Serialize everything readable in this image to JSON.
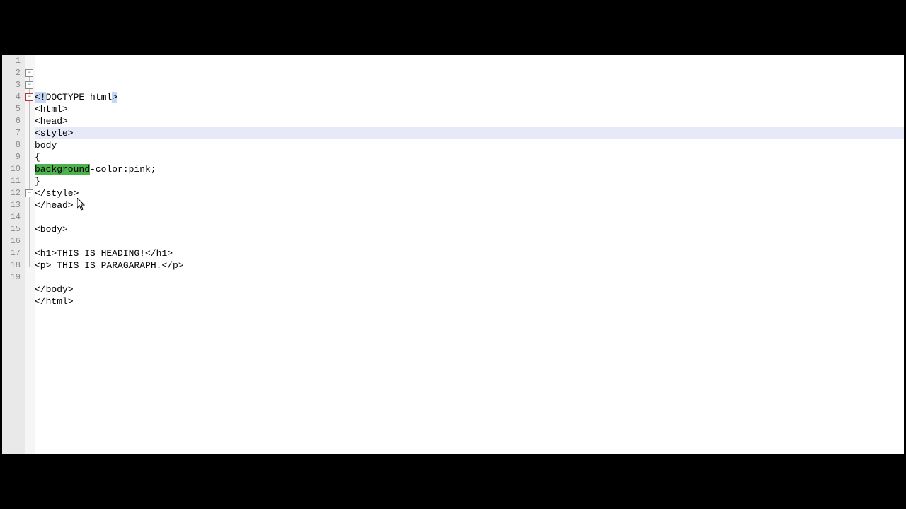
{
  "editor": {
    "line_count": 19,
    "highlighted_line": 7,
    "fold_markers": [
      {
        "line": 2,
        "collapsed": false
      },
      {
        "line": 3,
        "collapsed": false
      },
      {
        "line": 4,
        "collapsed": false,
        "red": true
      },
      {
        "line": 12,
        "collapsed": false
      }
    ],
    "cursor": {
      "line": 13,
      "col": 8
    },
    "lines": {
      "1": {
        "doctype_sel": "<!",
        "doctype_mid": "DOCTYPE html",
        "doctype_end": ">"
      },
      "2": "<html>",
      "3": "<head>",
      "4": "<style>",
      "5": "body",
      "6": "{",
      "7": {
        "green": "background",
        "rest": "-color:pink;"
      },
      "8": "}",
      "9": "</style>",
      "10": "</head>",
      "11": "",
      "12": "<body>",
      "13": "",
      "14": {
        "open": "<h1>",
        "text": "THIS IS HEADING!",
        "close": "</h1>"
      },
      "15": {
        "open": "<p>",
        "text": " THIS IS PARAGARAPH.",
        "close": "</p>"
      },
      "16": "",
      "17": "</body>",
      "18": "</html>",
      "19": ""
    }
  }
}
